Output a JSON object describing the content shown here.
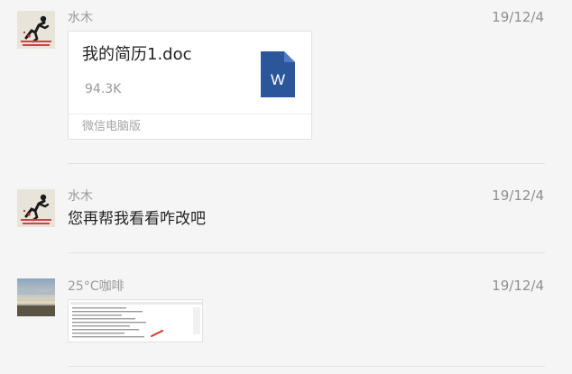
{
  "messages": [
    {
      "sender": "水木",
      "date": "19/12/4",
      "avatar_icon": "runner-avatar-icon",
      "file": {
        "name": "我的简历1.doc",
        "size": "94.3K",
        "source": "微信电脑版",
        "icon": "word-document-icon",
        "icon_letter": "W",
        "icon_color": "#2b579a"
      }
    },
    {
      "sender": "水木",
      "date": "19/12/4",
      "avatar_icon": "runner-avatar-icon",
      "text": "您再帮我看看咋改吧"
    },
    {
      "sender": "25°C咖啡",
      "date": "19/12/4",
      "avatar_icon": "landscape-avatar-icon",
      "image_icon": "document-screenshot-thumbnail"
    }
  ]
}
